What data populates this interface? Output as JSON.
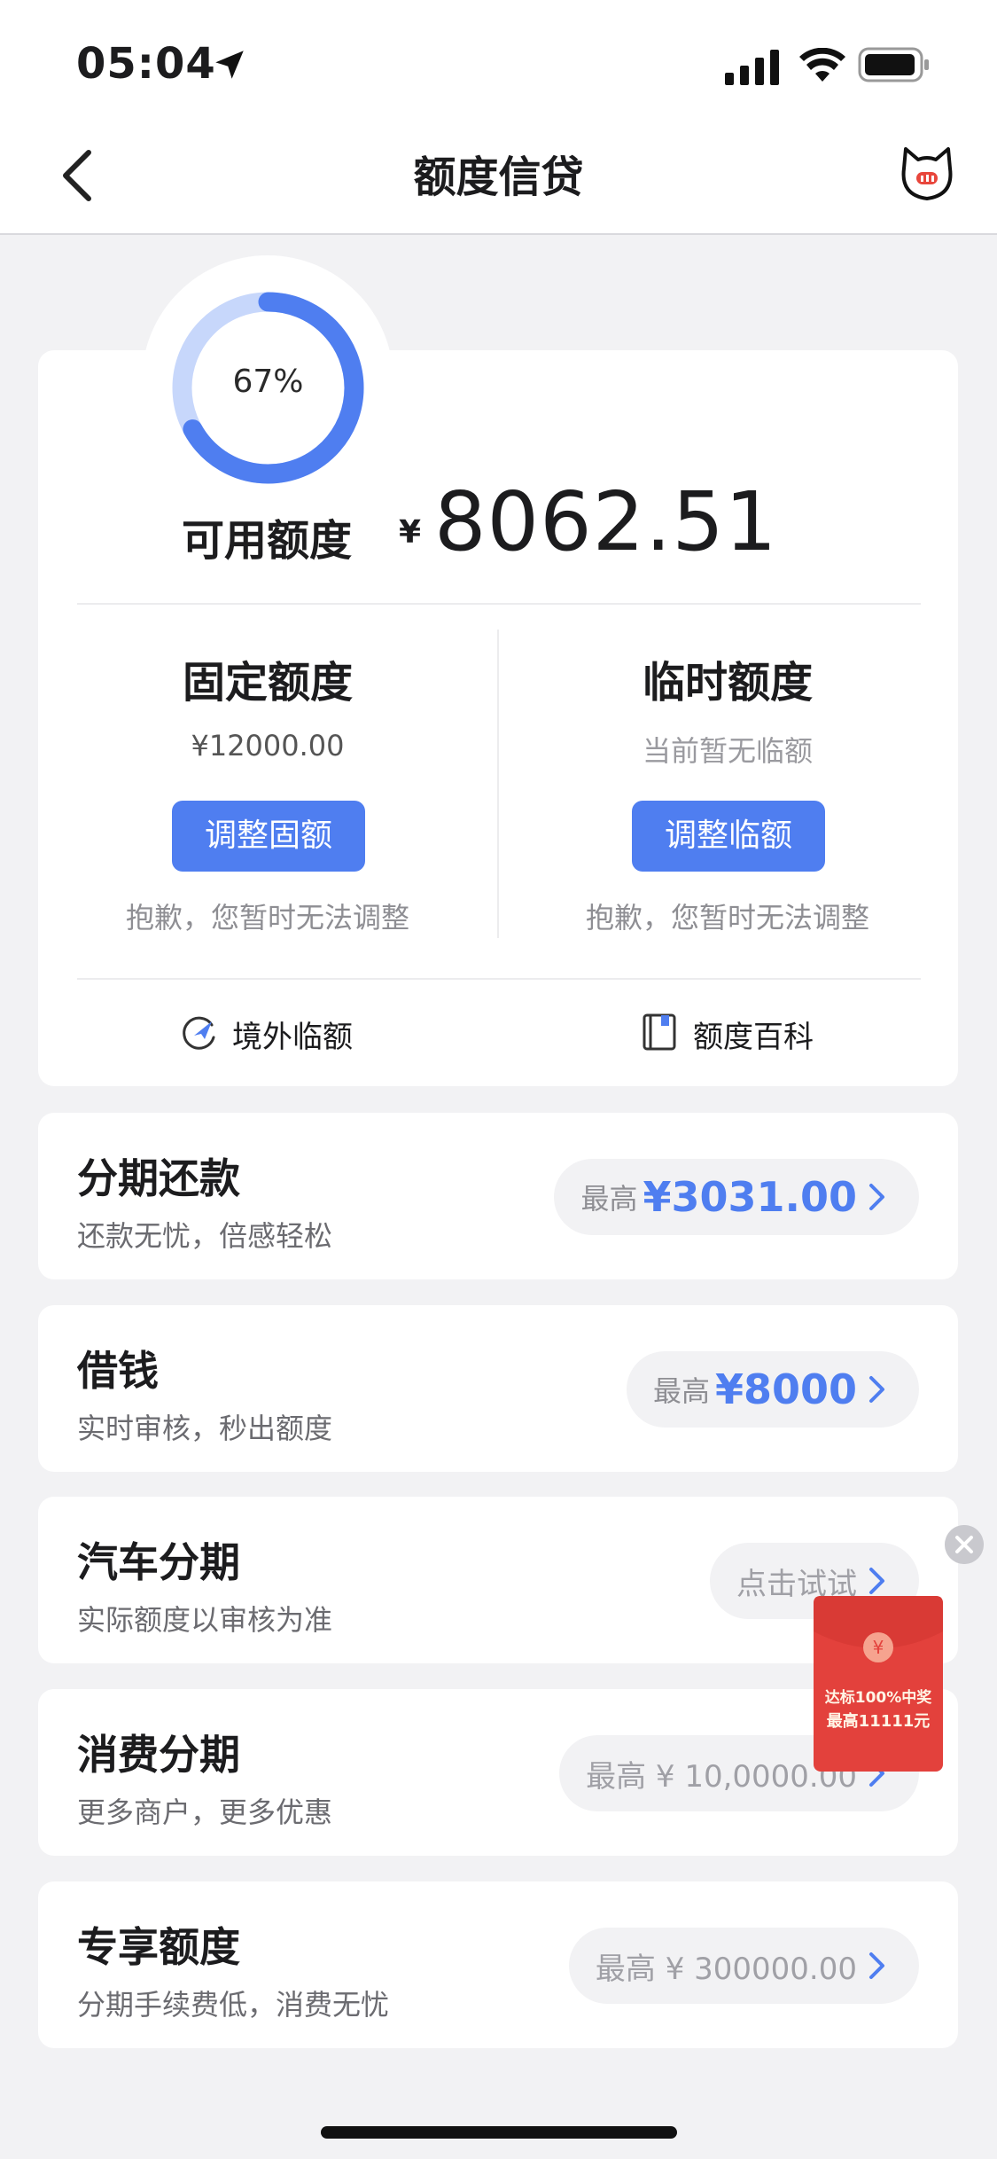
{
  "status_bar": {
    "time": "05:04"
  },
  "nav": {
    "title": "额度信贷"
  },
  "credit": {
    "percent_label": "67%",
    "percent": 0.67,
    "available_label": "可用额度",
    "currency": "¥",
    "available_amount": "8062.51"
  },
  "fixed": {
    "title": "固定额度",
    "value": "¥12000.00",
    "button": "调整固额",
    "note": "抱歉，您暂时无法调整"
  },
  "temporary": {
    "title": "临时额度",
    "value": "当前暂无临额",
    "button": "调整临额",
    "note": "抱歉，您暂时无法调整"
  },
  "links": {
    "overseas": "境外临额",
    "wiki": "额度百科"
  },
  "list": [
    {
      "title": "分期还款",
      "subtitle": "还款无忧，倍感轻松",
      "prefix": "最高",
      "value": "¥3031.00"
    },
    {
      "title": "借钱",
      "subtitle": "实时审核，秒出额度",
      "prefix": "最高",
      "value": "¥8000"
    },
    {
      "title": "汽车分期",
      "subtitle": "实际额度以审核为准",
      "prefix": "",
      "value": "点击试试"
    },
    {
      "title": "消费分期",
      "subtitle": "更多商户，更多优惠",
      "prefix": "",
      "value": "最高 ¥ 10,0000.00"
    },
    {
      "title": "专享额度",
      "subtitle": "分期手续费低，消费无忧",
      "prefix": "",
      "value": "最高 ¥ 300000.00"
    }
  ],
  "promo": {
    "line1": "达标100%中奖",
    "line2": "最高11111元",
    "coin": "¥"
  },
  "colors": {
    "accent": "#4f7ef0",
    "promo_red": "#e3413c"
  }
}
